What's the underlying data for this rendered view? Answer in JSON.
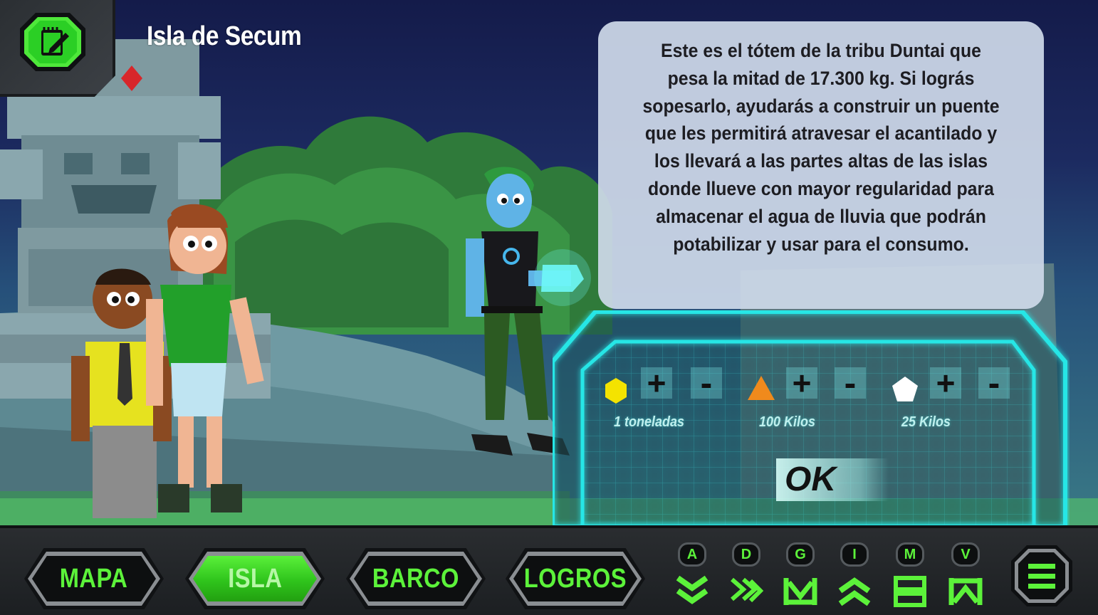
{
  "location": {
    "title": "Isla de Secum"
  },
  "dialog": {
    "text": "Este es el tótem de la tribu Duntai que pesa la mitad de 17.300 kg. Si lográs sopesarlo, ayudarás a construir un puente que les permitirá atravesar el acantilado y los llevará a las partes altas de las islas donde llueve con mayor regularidad para almacenar el agua de lluvia que podrán potabilizar y usar para el consumo."
  },
  "weights": [
    {
      "shape": "hexagon",
      "color": "#f4e300",
      "label": "1 toneladas",
      "plus": "+",
      "minus": "-"
    },
    {
      "shape": "triangle",
      "color": "#f08a1c",
      "label": "100 Kilos",
      "plus": "+",
      "minus": "-"
    },
    {
      "shape": "pentagon",
      "color": "#ffffff",
      "label": "25 Kilos",
      "plus": "+",
      "minus": "-"
    }
  ],
  "ok_label": "OK",
  "nav": [
    {
      "label": "MAPA",
      "active": false
    },
    {
      "label": "ISLA",
      "active": true
    },
    {
      "label": "BARCO",
      "active": false
    },
    {
      "label": "LOGROS",
      "active": false
    }
  ],
  "modes": [
    {
      "letter": "A",
      "icon": "double-chevron-down-icon"
    },
    {
      "letter": "D",
      "icon": "zigzag-arrows-icon"
    },
    {
      "letter": "G",
      "icon": "g-bracket-icon"
    },
    {
      "letter": "I",
      "icon": "double-chevron-up-icon"
    },
    {
      "letter": "M",
      "icon": "stacked-bars-icon"
    },
    {
      "letter": "V",
      "icon": "v-bracket-icon"
    }
  ],
  "colors": {
    "accent_green": "#5cf23a",
    "panel_cyan": "#27e6e6",
    "bar_dark": "#1c1f22"
  }
}
